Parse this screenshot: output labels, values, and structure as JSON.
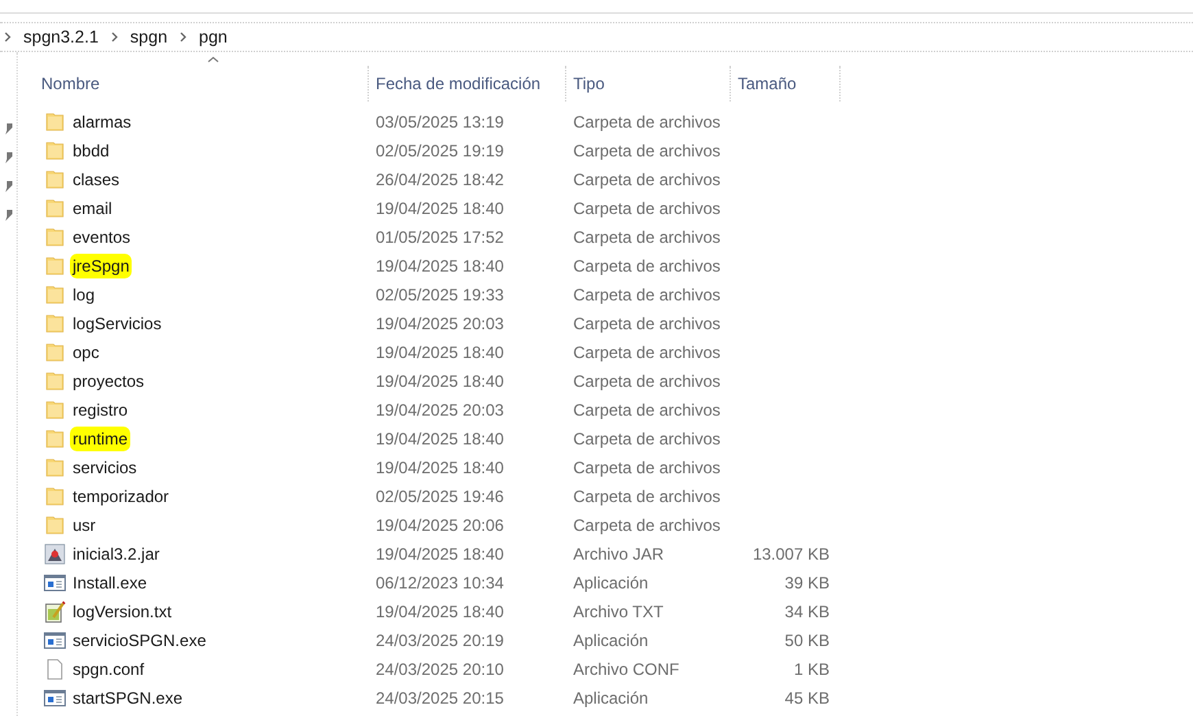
{
  "breadcrumb": [
    "spgn3.2.1",
    "spgn",
    "pgn"
  ],
  "columns": [
    {
      "label": "Nombre",
      "sorted": true
    },
    {
      "label": "Fecha de modificación",
      "sorted": false
    },
    {
      "label": "Tipo",
      "sorted": false
    },
    {
      "label": "Tamaño",
      "sorted": false
    }
  ],
  "files": [
    {
      "name": "alarmas",
      "date": "03/05/2025 13:19",
      "type": "Carpeta de archivos",
      "kind": "folder",
      "highlighted": false
    },
    {
      "name": "bbdd",
      "date": "02/05/2025 19:19",
      "type": "Carpeta de archivos",
      "kind": "folder",
      "highlighted": false
    },
    {
      "name": "clases",
      "date": "26/04/2025 18:42",
      "type": "Carpeta de archivos",
      "kind": "folder",
      "highlighted": false
    },
    {
      "name": "email",
      "date": "19/04/2025 18:40",
      "type": "Carpeta de archivos",
      "kind": "folder",
      "highlighted": false
    },
    {
      "name": "eventos",
      "date": "01/05/2025 17:52",
      "type": "Carpeta de archivos",
      "kind": "folder",
      "highlighted": false
    },
    {
      "name": "jreSpgn",
      "date": "19/04/2025 18:40",
      "type": "Carpeta de archivos",
      "kind": "folder",
      "highlighted": true
    },
    {
      "name": "log",
      "date": "02/05/2025 19:33",
      "type": "Carpeta de archivos",
      "kind": "folder",
      "highlighted": false
    },
    {
      "name": "logServicios",
      "date": "19/04/2025 20:03",
      "type": "Carpeta de archivos",
      "kind": "folder",
      "highlighted": false
    },
    {
      "name": "opc",
      "date": "19/04/2025 18:40",
      "type": "Carpeta de archivos",
      "kind": "folder",
      "highlighted": false
    },
    {
      "name": "proyectos",
      "date": "19/04/2025 18:40",
      "type": "Carpeta de archivos",
      "kind": "folder",
      "highlighted": false
    },
    {
      "name": "registro",
      "date": "19/04/2025 20:03",
      "type": "Carpeta de archivos",
      "kind": "folder",
      "highlighted": false
    },
    {
      "name": "runtime",
      "date": "19/04/2025 18:40",
      "type": "Carpeta de archivos",
      "kind": "folder",
      "highlighted": true
    },
    {
      "name": "servicios",
      "date": "19/04/2025 18:40",
      "type": "Carpeta de archivos",
      "kind": "folder",
      "highlighted": false
    },
    {
      "name": "temporizador",
      "date": "02/05/2025 19:46",
      "type": "Carpeta de archivos",
      "kind": "folder",
      "highlighted": false
    },
    {
      "name": "usr",
      "date": "19/04/2025 20:06",
      "type": "Carpeta de archivos",
      "kind": "folder",
      "highlighted": false
    },
    {
      "name": "inicial3.2.jar",
      "date": "19/04/2025 18:40",
      "type": "Archivo JAR",
      "size": "13.007 KB",
      "kind": "jar",
      "highlighted": false
    },
    {
      "name": "Install.exe",
      "date": "06/12/2023 10:34",
      "type": "Aplicación",
      "size": "39 KB",
      "kind": "exe",
      "highlighted": false
    },
    {
      "name": "logVersion.txt",
      "date": "19/04/2025 18:40",
      "type": "Archivo TXT",
      "size": "34 KB",
      "kind": "txt",
      "highlighted": false
    },
    {
      "name": "servicioSPGN.exe",
      "date": "24/03/2025 20:19",
      "type": "Aplicación",
      "size": "50 KB",
      "kind": "exe",
      "highlighted": false
    },
    {
      "name": "spgn.conf",
      "date": "24/03/2025 20:10",
      "type": "Archivo CONF",
      "size": "1 KB",
      "kind": "file",
      "highlighted": false
    },
    {
      "name": "startSPGN.exe",
      "date": "24/03/2025 20:15",
      "type": "Aplicación",
      "size": "45 KB",
      "kind": "exe",
      "highlighted": false
    }
  ]
}
